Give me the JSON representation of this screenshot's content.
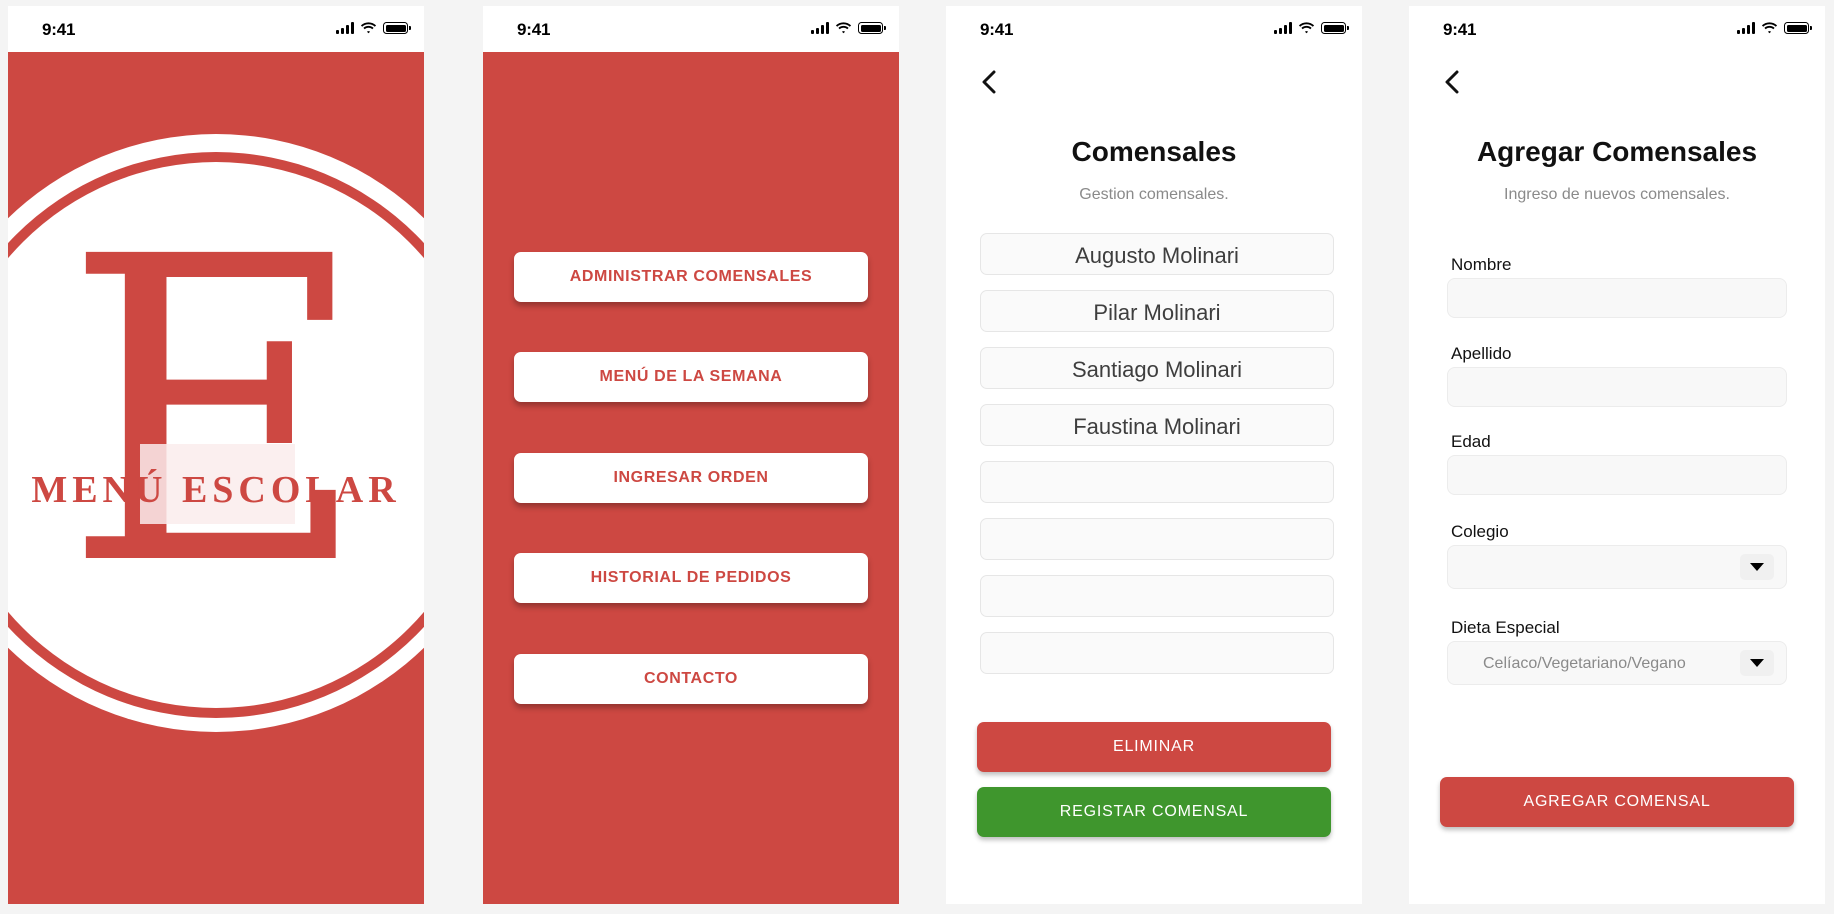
{
  "status_bar": {
    "time": "9:41"
  },
  "splash": {
    "letter": "E",
    "title": "MENÚ ESCOLAR"
  },
  "main_menu": {
    "items": [
      "ADMINISTRAR COMENSALES",
      "MENÚ DE LA SEMANA",
      "INGRESAR ORDEN",
      "HISTORIAL DE PEDIDOS",
      "CONTACTO"
    ]
  },
  "comensales": {
    "title": "Comensales",
    "subtitle": "Gestion comensales.",
    "names": [
      "Augusto Molinari",
      "Pilar Molinari",
      "Santiago Molinari",
      "Faustina Molinari",
      "",
      "",
      "",
      ""
    ],
    "delete_label": "ELIMINAR",
    "register_label": "REGISTAR COMENSAL"
  },
  "agregar": {
    "title": "Agregar Comensales",
    "subtitle": "Ingreso de nuevos comensales.",
    "nombre_label": "Nombre",
    "apellido_label": "Apellido",
    "edad_label": "Edad",
    "colegio_label": "Colegio",
    "colegio_value": "",
    "dieta_label": "Dieta Especial",
    "dieta_value": "Celíaco/Vegetariano/Vegano",
    "submit_label": "AGREGAR COMENSAL"
  },
  "colors": {
    "brand_red": "#cd4842",
    "brand_green": "#3f962d"
  }
}
